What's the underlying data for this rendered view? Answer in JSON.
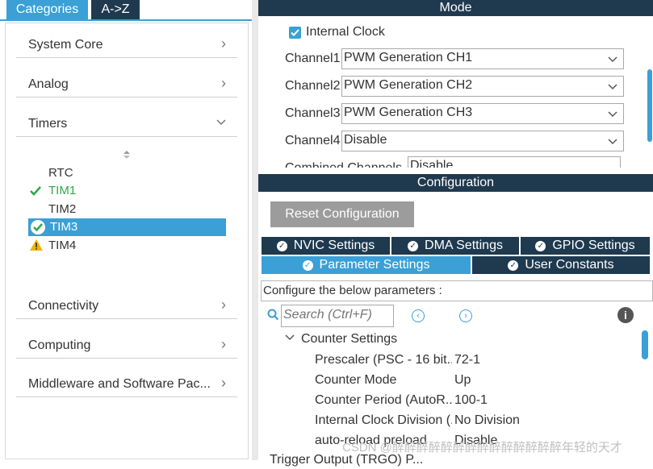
{
  "left": {
    "tabs": [
      "Categories",
      "A->Z"
    ],
    "categories": [
      {
        "label": "System Core"
      },
      {
        "label": "Analog"
      },
      {
        "label": "Timers"
      },
      {
        "label": "Connectivity"
      },
      {
        "label": "Computing"
      },
      {
        "label": "Middleware and Software Pac..."
      }
    ],
    "timers": [
      {
        "label": "RTC",
        "status": "none"
      },
      {
        "label": "TIM1",
        "status": "configured"
      },
      {
        "label": "TIM2",
        "status": "none"
      },
      {
        "label": "TIM3",
        "status": "selected"
      },
      {
        "label": "TIM4",
        "status": "warning"
      }
    ]
  },
  "mode": {
    "header": "Mode",
    "internal_clock_label": "Internal Clock",
    "internal_clock_checked": true,
    "channels": [
      {
        "label": "Channel1",
        "value": "PWM Generation CH1"
      },
      {
        "label": "Channel2",
        "value": "PWM Generation CH2"
      },
      {
        "label": "Channel3",
        "value": "PWM Generation CH3"
      },
      {
        "label": "Channel4",
        "value": "Disable"
      }
    ],
    "cutoff_label": "Combined Channels",
    "cutoff_value": "Disable"
  },
  "configuration": {
    "header": "Configuration",
    "reset_button": "Reset Configuration",
    "tabs_row1": [
      "NVIC Settings",
      "DMA Settings",
      "GPIO Settings"
    ],
    "tabs_row2": [
      "Parameter Settings",
      "User Constants"
    ],
    "active_tab": "Parameter Settings",
    "banner": "Configure the below parameters :",
    "search_placeholder": "Search (Ctrl+F)",
    "section": "Counter Settings",
    "params": [
      {
        "key": "Prescaler (PSC - 16 bit...",
        "value": "72-1"
      },
      {
        "key": "Counter Mode",
        "value": "Up"
      },
      {
        "key": "Counter Period (AutoR...",
        "value": "100-1"
      },
      {
        "key": "Internal Clock Division (...",
        "value": "No Division"
      },
      {
        "key": "auto-reload preload",
        "value": "Disable"
      }
    ],
    "next_section": "Trigger Output (TRGO) P..."
  },
  "watermark": "CSDN @醉醉醉醉醉醉醉醉醉醉醉醉醉醉年轻的天才",
  "colors": {
    "accent": "#3aa0d6",
    "dark_header": "#1f3a4f",
    "warning": "#f0b400",
    "ok": "#2fa84a"
  }
}
